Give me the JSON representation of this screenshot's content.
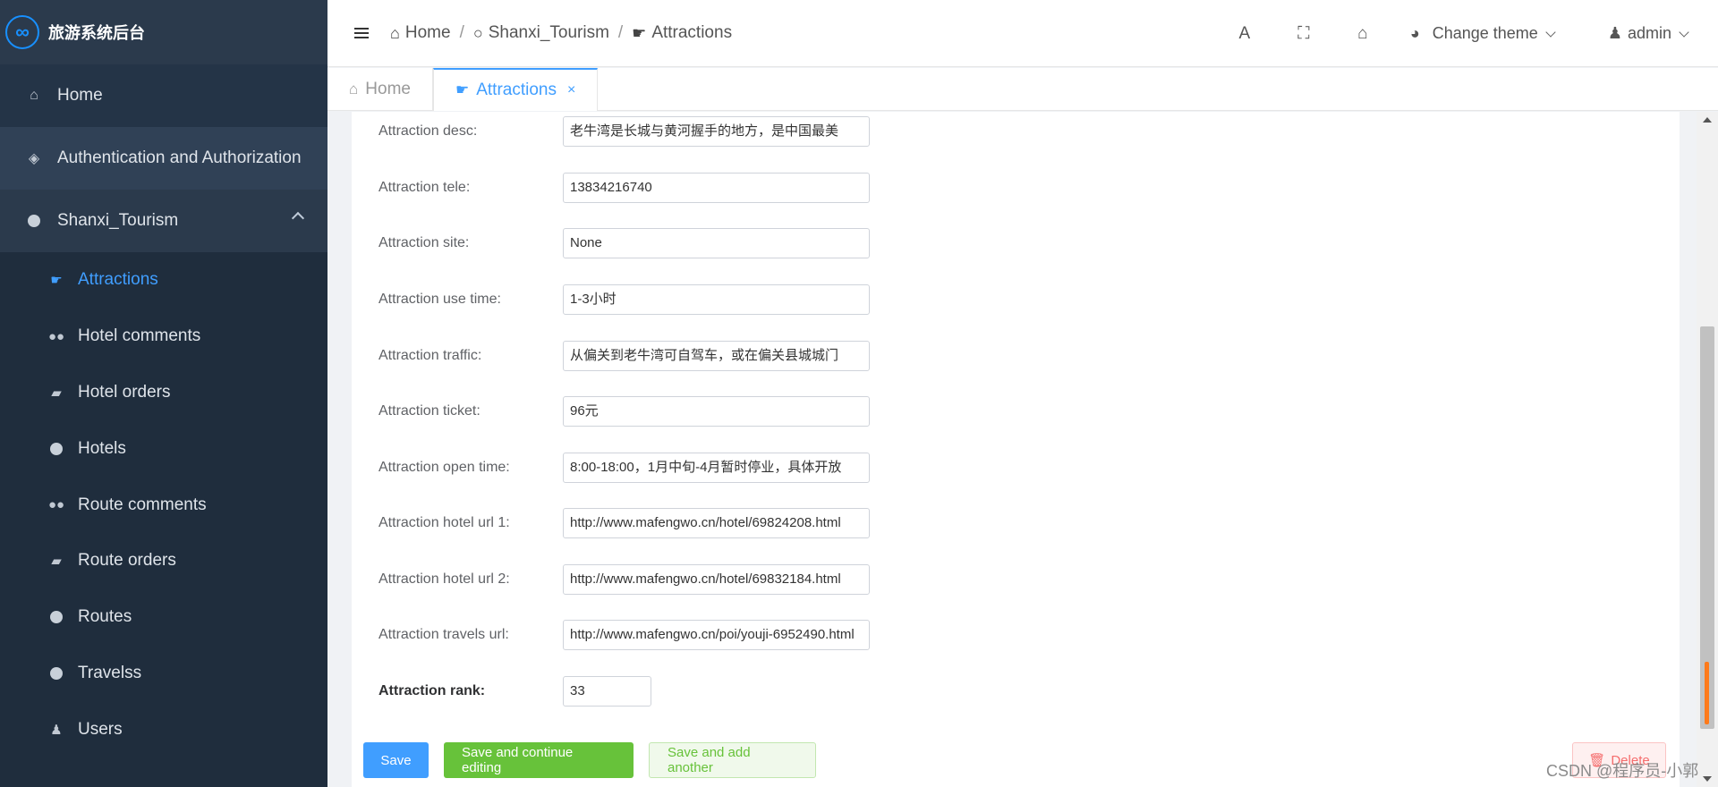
{
  "brand": {
    "title": "旅游系统后台",
    "logo_glyph": "∞"
  },
  "sidebar": {
    "home": "Home",
    "auth": "Authentication and Authorization",
    "group": "Shanxi_Tourism",
    "items": [
      {
        "label": "Attractions",
        "icon": "attractions-icon",
        "active": true
      },
      {
        "label": "Hotel comments",
        "icon": "comments-icon"
      },
      {
        "label": "Hotel orders",
        "icon": "bag-icon"
      },
      {
        "label": "Hotels",
        "icon": "circle-icon"
      },
      {
        "label": "Route comments",
        "icon": "comments-icon"
      },
      {
        "label": "Route orders",
        "icon": "bag-icon"
      },
      {
        "label": "Routes",
        "icon": "circle-icon"
      },
      {
        "label": "Travelss",
        "icon": "circle-icon"
      },
      {
        "label": "Users",
        "icon": "user-icon"
      }
    ]
  },
  "header": {
    "breadcrumb": [
      "Home",
      "Shanxi_Tourism",
      "Attractions"
    ],
    "change_theme": "Change theme",
    "user": "admin"
  },
  "tabs": {
    "home": "Home",
    "attractions": "Attractions",
    "close_glyph": "×"
  },
  "form": {
    "fields": [
      {
        "label": "Attraction desc:",
        "value": "老牛湾是长城与黄河握手的地方，是中国最美"
      },
      {
        "label": "Attraction tele:",
        "value": "13834216740"
      },
      {
        "label": "Attraction site:",
        "value": "None"
      },
      {
        "label": "Attraction use time:",
        "value": "1-3小时"
      },
      {
        "label": "Attraction traffic:",
        "value": "从偏关到老牛湾可自驾车，或在偏关县城城门"
      },
      {
        "label": "Attraction ticket:",
        "value": "96元"
      },
      {
        "label": "Attraction open time:",
        "value": "8:00-18:00，1月中旬-4月暂时停业，具体开放"
      },
      {
        "label": "Attraction hotel url 1:",
        "value": "http://www.mafengwo.cn/hotel/69824208.html"
      },
      {
        "label": "Attraction hotel url 2:",
        "value": "http://www.mafengwo.cn/hotel/69832184.html"
      },
      {
        "label": "Attraction travels url:",
        "value": "http://www.mafengwo.cn/poi/youji-6952490.html"
      },
      {
        "label": "Attraction rank:",
        "value": "33"
      }
    ]
  },
  "actions": {
    "save": "Save",
    "save_continue": "Save and continue editing",
    "save_add": "Save and add another",
    "delete": "Delete"
  },
  "watermark": "CSDN @程序员-小郭"
}
